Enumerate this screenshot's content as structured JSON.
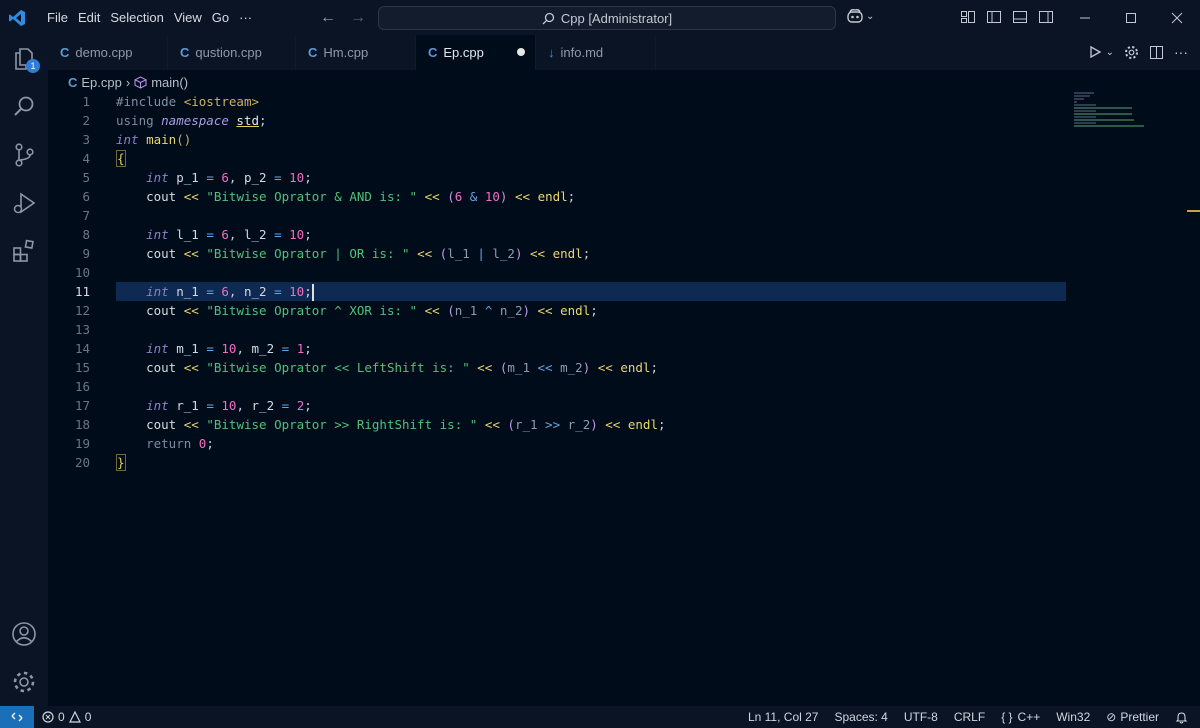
{
  "menu": [
    "File",
    "Edit",
    "Selection",
    "View",
    "Go",
    "···"
  ],
  "search": {
    "label": "Cpp [Administrator]"
  },
  "tabs": [
    {
      "label": "demo.cpp",
      "icon": "cpp-icon",
      "active": false
    },
    {
      "label": "qustion.cpp",
      "icon": "cpp-icon",
      "active": false
    },
    {
      "label": "Hm.cpp",
      "icon": "cpp-icon",
      "active": false
    },
    {
      "label": "Ep.cpp",
      "icon": "cpp-icon",
      "active": true,
      "modified": true
    },
    {
      "label": "info.md",
      "icon": "markdown-icon",
      "active": false
    }
  ],
  "breadcrumb": {
    "file": "Ep.cpp",
    "symbol": "main()"
  },
  "activity": {
    "badge": "1"
  },
  "editor": {
    "line_numbers": [
      "1",
      "2",
      "3",
      "4",
      "5",
      "6",
      "7",
      "8",
      "9",
      "10",
      "11",
      "12",
      "13",
      "14",
      "15",
      "16",
      "17",
      "18",
      "19",
      "20"
    ],
    "current_line": "11",
    "lines": [
      "#include <iostream>",
      "using namespace std;",
      "int main()",
      "{",
      "    int p_1 = 6, p_2 = 10;",
      "    cout << \"Bitwise Oprator & AND is: \" << (6 & 10) << endl;",
      "",
      "    int l_1 = 6, l_2 = 10;",
      "    cout << \"Bitwise Oprator | OR is: \" << (l_1 | l_2) << endl;",
      "",
      "    int n_1 = 6, n_2 = 10;",
      "    cout << \"Bitwise Oprator ^ XOR is: \" << (n_1 ^ n_2) << endl;",
      "",
      "    int m_1 = 10, m_2 = 1;",
      "    cout << \"Bitwise Oprator << LeftShift is: \" << (m_1 << m_2) << endl;",
      "",
      "    int r_1 = 10, r_2 = 2;",
      "    cout << \"Bitwise Oprator >> RightShift is: \" << (r_1 >> r_2) << endl;",
      "    return 0;",
      "}"
    ]
  },
  "status": {
    "errors": "0",
    "warnings": "0",
    "position": "Ln 11, Col 27",
    "spaces": "Spaces: 4",
    "encoding": "UTF-8",
    "eol": "CRLF",
    "language": "C++",
    "platform": "Win32",
    "formatter": "Prettier"
  }
}
